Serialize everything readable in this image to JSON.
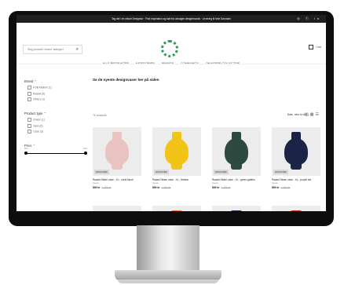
{
  "topbar": {
    "text": "Tag del i en virtuel Designtur · Find inspiration og køb fra udvalgte designbrands · Levering til hele Danmark",
    "social": "◎ ⓕ in"
  },
  "header": {
    "search_placeholder": "Søg produkt, brand, kategori",
    "cart_label": "Cart"
  },
  "nav": [
    "ALLE PRODUKTER",
    "KATEGORIER",
    "BRANDS",
    "COMMUNITY",
    "OM KEEPR COLLECTIVE"
  ],
  "sidebar": {
    "brand": {
      "title": "Brand",
      "options": [
        "FOB Melkim (1)",
        "Raawii (6)",
        "Others (1)"
      ]
    },
    "product_type": {
      "title": "Product type",
      "options": [
        "Chairs (1)",
        "Vase (6)",
        "Case (3)"
      ]
    },
    "price": {
      "title": "Price",
      "min": "0 kr",
      "max": "0 kr"
    }
  },
  "main": {
    "heading": "Se de nyeste designvaser her på siden",
    "count": "76 products",
    "sort": "Date, new to old",
    "products": [
      {
        "badge": "DISCOVER",
        "name": "Raawii Strøm vase - XL - coral blush",
        "brand": "Raawii",
        "price": "800 kr",
        "old_price": "1 400 kr",
        "color": "#e8c3c0"
      },
      {
        "badge": "DISCOVER",
        "name": "Raawii Strøm vase - XL - freesia",
        "brand": "Raawii",
        "price": "800 kr",
        "old_price": "1 400 kr",
        "color": "#f2c418"
      },
      {
        "badge": "DISCOVER",
        "name": "Raawii Strøm vase - XL - green gables",
        "brand": "Raawii",
        "price": "800 kr",
        "old_price": "1 400 kr",
        "color": "#2d4a40"
      },
      {
        "badge": "DISCOVER",
        "name": "Raawii Strøm vase - XL - purple set",
        "brand": "Raawii",
        "price": "800 kr",
        "old_price": "1 400 kr",
        "color": "#1b2347"
      }
    ],
    "row2_colors": [
      "#e9e9e9",
      "#e8641b",
      "#1f2a48",
      "#c81e1e"
    ]
  }
}
